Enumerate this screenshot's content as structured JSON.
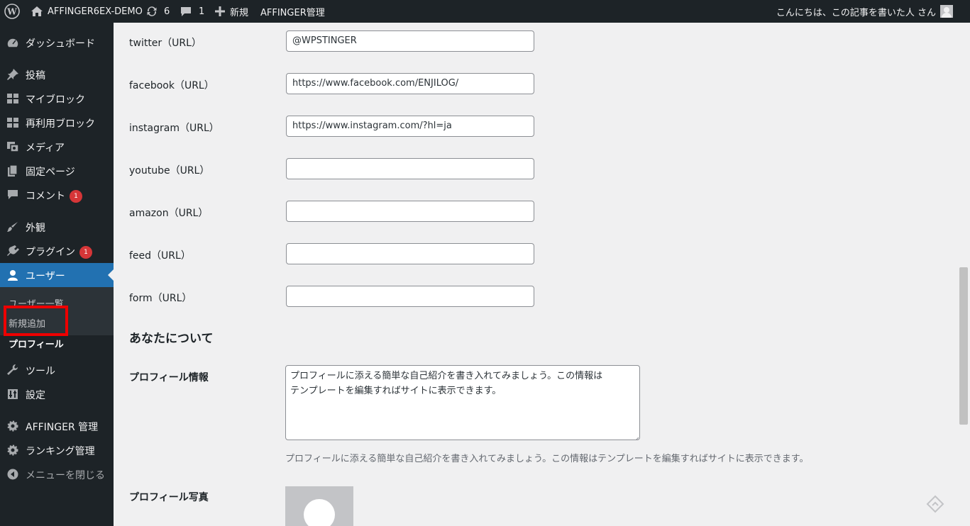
{
  "adminbar": {
    "site_name": "AFFINGER6EX-DEMO",
    "updates_count": "6",
    "comments_count": "1",
    "new_label": "新規",
    "affinger_label": "AFFINGER管理",
    "greeting": "こんにちは、この記事を書いた人 さん"
  },
  "sidebar": {
    "items": [
      {
        "label": "ダッシュボード",
        "icon": "dashboard-icon"
      },
      {
        "label": "投稿",
        "icon": "pin-icon"
      },
      {
        "label": "マイブロック",
        "icon": "grid-icon"
      },
      {
        "label": "再利用ブロック",
        "icon": "grid-icon"
      },
      {
        "label": "メディア",
        "icon": "media-icon"
      },
      {
        "label": "固定ページ",
        "icon": "page-icon"
      },
      {
        "label": "コメント",
        "icon": "comment-icon",
        "badge": "1"
      },
      {
        "label": "外観",
        "icon": "brush-icon"
      },
      {
        "label": "プラグイン",
        "icon": "plugin-icon",
        "badge": "1"
      },
      {
        "label": "ユーザー",
        "icon": "user-icon"
      },
      {
        "label": "ツール",
        "icon": "wrench-icon"
      },
      {
        "label": "設定",
        "icon": "settings-icon"
      },
      {
        "label": "AFFINGER 管理",
        "icon": "gear-icon"
      },
      {
        "label": "ランキング管理",
        "icon": "gear-icon"
      },
      {
        "label": "メニューを閉じる",
        "icon": "collapse-icon"
      }
    ],
    "submenu": {
      "user_list": "ユーザー一覧",
      "add_new": "新規追加",
      "profile": "プロフィール"
    }
  },
  "form": {
    "twitter_label": "twitter（URL）",
    "twitter_value": "@WPSTINGER",
    "facebook_label": "facebook（URL）",
    "facebook_value": "https://www.facebook.com/ENJILOG/",
    "instagram_label": "instagram（URL）",
    "instagram_value": "https://www.instagram.com/?hl=ja",
    "youtube_label": "youtube（URL）",
    "youtube_value": "",
    "amazon_label": "amazon（URL）",
    "amazon_value": "",
    "feed_label": "feed（URL）",
    "feed_value": "",
    "form_label": "form（URL）",
    "form_value": "",
    "about_title": "あなたについて",
    "bio_label": "プロフィール情報",
    "bio_line1": "プロフィールに添える簡単な自己紹介を書き入れてみましょう。この情報は",
    "bio_line2": "テンプレートを編集すればサイトに表示できます。",
    "bio_description": "プロフィールに添える簡単な自己紹介を書き入れてみましょう。この情報はテンプレートを編集すればサイトに表示できます。",
    "photo_label": "プロフィール写真"
  },
  "colors": {
    "adminbar_bg": "#1d2327",
    "accent": "#2271b1",
    "badge": "#d63638",
    "highlight": "#ee0000"
  }
}
